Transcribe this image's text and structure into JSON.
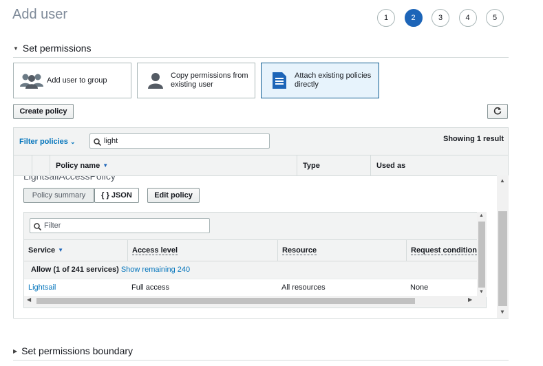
{
  "page": {
    "title": "Add user",
    "steps": [
      "1",
      "2",
      "3",
      "4",
      "5"
    ],
    "active_step": "2"
  },
  "set_permissions": {
    "title": "Set permissions",
    "options": [
      {
        "label": "Add user to group",
        "icon": "users-group-icon"
      },
      {
        "label": "Copy permissions from existing user",
        "icon": "user-icon"
      },
      {
        "label": "Attach existing policies directly",
        "icon": "document-icon",
        "selected": true
      }
    ]
  },
  "toolbar": {
    "create_policy_label": "Create policy",
    "refresh_icon": "refresh-icon"
  },
  "policy_table": {
    "filter_label": "Filter policies",
    "search_value": "light",
    "result_count": "Showing 1 result",
    "columns": [
      "Policy name",
      "Type",
      "Used as"
    ]
  },
  "policy_detail": {
    "policy_name": "LightsailAccessPolicy",
    "tabs": {
      "summary": "Policy summary",
      "json": "{ } JSON",
      "edit": "Edit policy"
    },
    "filter_placeholder": "Filter",
    "columns": [
      "Service",
      "Access level",
      "Resource",
      "Request condition"
    ],
    "group_row": {
      "label": "Allow (1 of 241 services)",
      "link": "Show remaining 240"
    },
    "rows": [
      {
        "service": "Lightsail",
        "access_level": "Full access",
        "resource": "All resources",
        "condition": "None"
      }
    ]
  },
  "set_permissions_boundary": {
    "title": "Set permissions boundary"
  },
  "colors": {
    "accent": "#1d65b8",
    "link": "#0073bb",
    "selected_card_bg": "#e7f3fc"
  }
}
